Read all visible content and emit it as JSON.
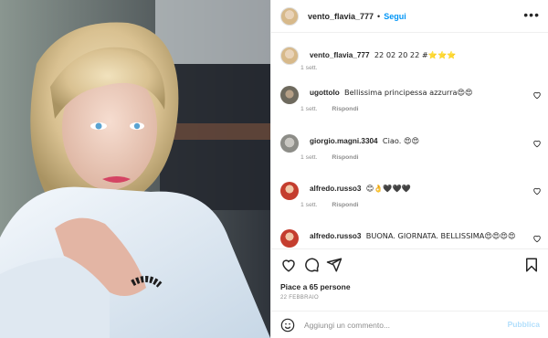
{
  "post_header": {
    "username": "vento_flavia_777",
    "separator": "•",
    "follow_label": "Segui",
    "more_icon": "more-icon"
  },
  "caption": {
    "username": "vento_flavia_777",
    "text": "22 02 20 22 #⭐⭐⭐",
    "time": "1 sett."
  },
  "comments": [
    {
      "username": "ugottolo",
      "text": "Bellissima principessa azzurra😍😍",
      "time": "1 sett.",
      "reply_label": "Rispondi"
    },
    {
      "username": "giorgio.magni.3304",
      "text": "Ciao. 😍😍",
      "time": "1 sett.",
      "reply_label": "Rispondi"
    },
    {
      "username": "alfredo.russo3",
      "text": "😊👌🖤🖤🖤",
      "time": "1 sett.",
      "reply_label": "Rispondi"
    },
    {
      "username": "alfredo.russo3",
      "text": "BUONA. GIORNATA. BELLISSIMA😍😍😍😍",
      "time": "",
      "reply_label": ""
    }
  ],
  "footer": {
    "likes_text": "Piace a 65 persone",
    "date": "22 FEBBRAIO",
    "comment_placeholder": "Aggiungi un commento...",
    "publish_label": "Pubblica"
  },
  "colors": {
    "accent": "#0095f6",
    "muted": "#8e8e8e",
    "publish_disabled": "#b2dffc"
  }
}
